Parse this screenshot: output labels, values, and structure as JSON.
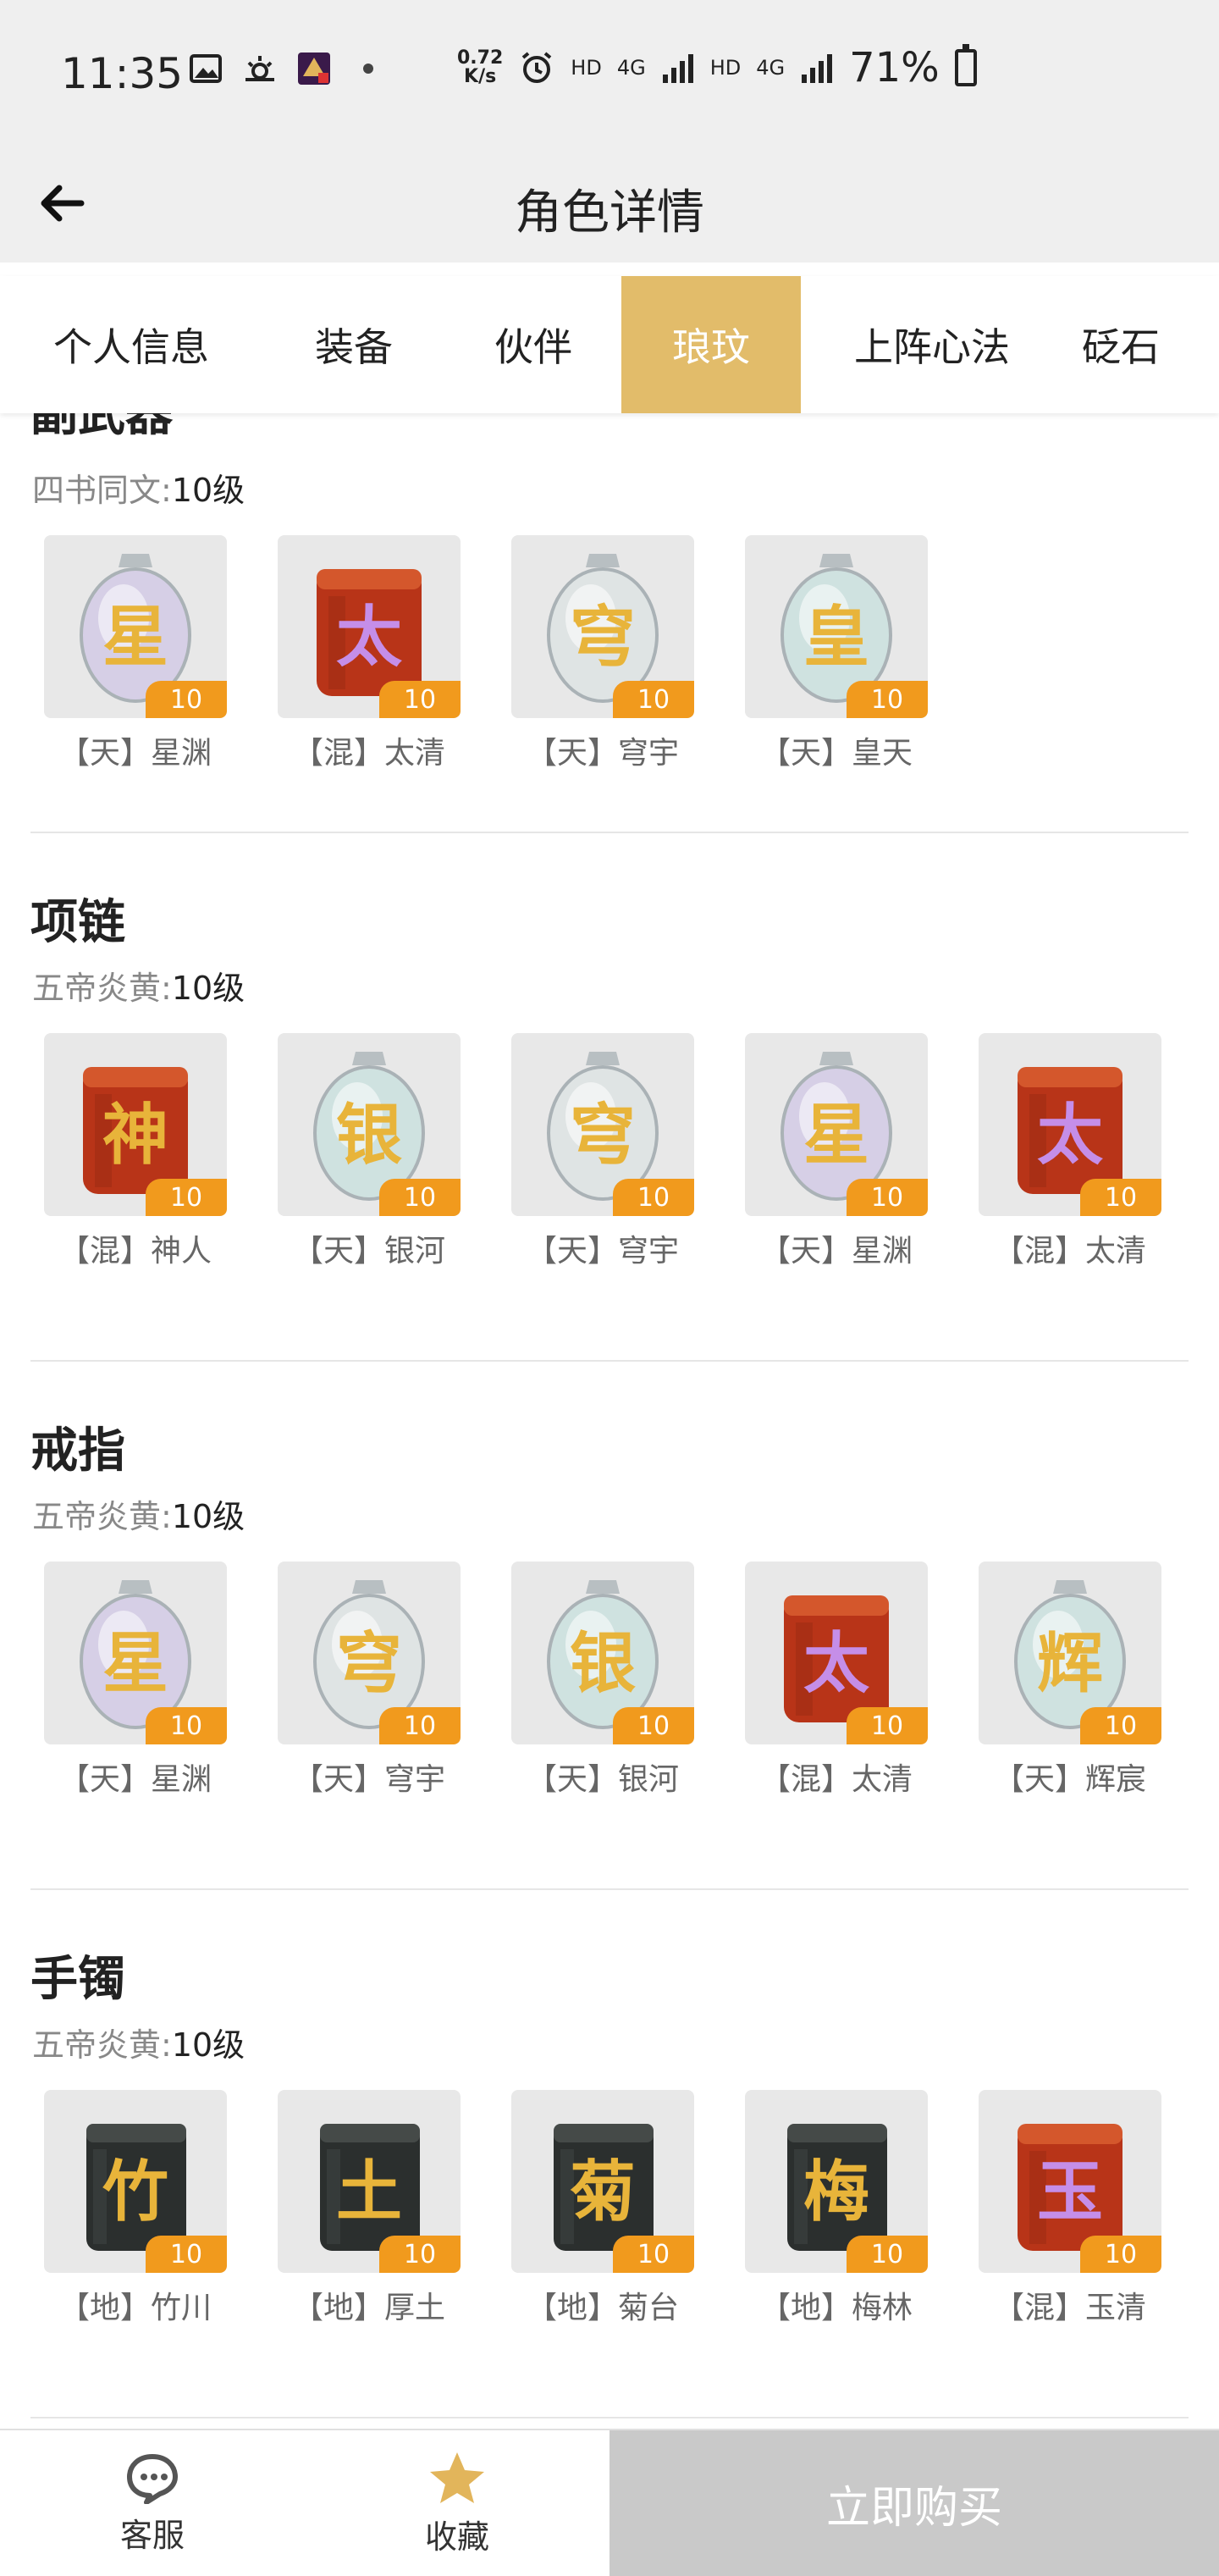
{
  "status_bar": {
    "time": "11:35",
    "speed_top": "0.72",
    "speed_bottom": "K/s",
    "net1": "HD",
    "net2": "4G",
    "net3": "HD",
    "net4": "4G",
    "battery": "71%"
  },
  "header": {
    "title": "角色详情"
  },
  "tabs": [
    {
      "label": "个人信息"
    },
    {
      "label": "装备"
    },
    {
      "label": "伙伴"
    },
    {
      "label": "琅玟"
    },
    {
      "label": "上阵心法"
    },
    {
      "label": "砭石"
    }
  ],
  "partial_section": {
    "title": "副武器",
    "sub_label": "四书同文:",
    "sub_level": "10级",
    "items": [
      {
        "name": "【天】星渊",
        "level": "10",
        "style": "silver-purple",
        "glyph": "星"
      },
      {
        "name": "【混】太清",
        "level": "10",
        "style": "red",
        "glyph": "太"
      },
      {
        "name": "【天】穹宇",
        "level": "10",
        "style": "silver",
        "glyph": "穹"
      },
      {
        "name": "【天】皇天",
        "level": "10",
        "style": "silver-teal",
        "glyph": "皇"
      }
    ]
  },
  "sections": [
    {
      "title": "项链",
      "sub_label": "五帝炎黄:",
      "sub_level": "10级",
      "items": [
        {
          "name": "【混】神人",
          "level": "10",
          "style": "red-gold",
          "glyph": "神"
        },
        {
          "name": "【天】银河",
          "level": "10",
          "style": "silver-teal",
          "glyph": "银"
        },
        {
          "name": "【天】穹宇",
          "level": "10",
          "style": "silver",
          "glyph": "穹"
        },
        {
          "name": "【天】星渊",
          "level": "10",
          "style": "silver-purple",
          "glyph": "星"
        },
        {
          "name": "【混】太清",
          "level": "10",
          "style": "red",
          "glyph": "太"
        }
      ]
    },
    {
      "title": "戒指",
      "sub_label": "五帝炎黄:",
      "sub_level": "10级",
      "items": [
        {
          "name": "【天】星渊",
          "level": "10",
          "style": "silver-purple",
          "glyph": "星"
        },
        {
          "name": "【天】穹宇",
          "level": "10",
          "style": "silver",
          "glyph": "穹"
        },
        {
          "name": "【天】银河",
          "level": "10",
          "style": "silver-teal",
          "glyph": "银"
        },
        {
          "name": "【混】太清",
          "level": "10",
          "style": "red",
          "glyph": "太"
        },
        {
          "name": "【天】辉宸",
          "level": "10",
          "style": "silver-teal",
          "glyph": "辉"
        }
      ]
    },
    {
      "title": "手镯",
      "sub_label": "五帝炎黄:",
      "sub_level": "10级",
      "items": [
        {
          "name": "【地】竹川",
          "level": "10",
          "style": "dark",
          "glyph": "竹"
        },
        {
          "name": "【地】厚土",
          "level": "10",
          "style": "dark",
          "glyph": "土"
        },
        {
          "name": "【地】菊台",
          "level": "10",
          "style": "dark",
          "glyph": "菊"
        },
        {
          "name": "【地】梅林",
          "level": "10",
          "style": "dark",
          "glyph": "梅"
        },
        {
          "name": "【混】玉清",
          "level": "10",
          "style": "red",
          "glyph": "玉"
        }
      ]
    }
  ],
  "bottom_bar": {
    "service_label": "客服",
    "favorite_label": "收藏",
    "buy_label": "立即购买"
  },
  "colors": {
    "tab_active": "#e2bc6a",
    "level_badge": "#f19a1d",
    "buy_disabled": "#c9c9c9",
    "favorite_star": "#e2b55b"
  }
}
